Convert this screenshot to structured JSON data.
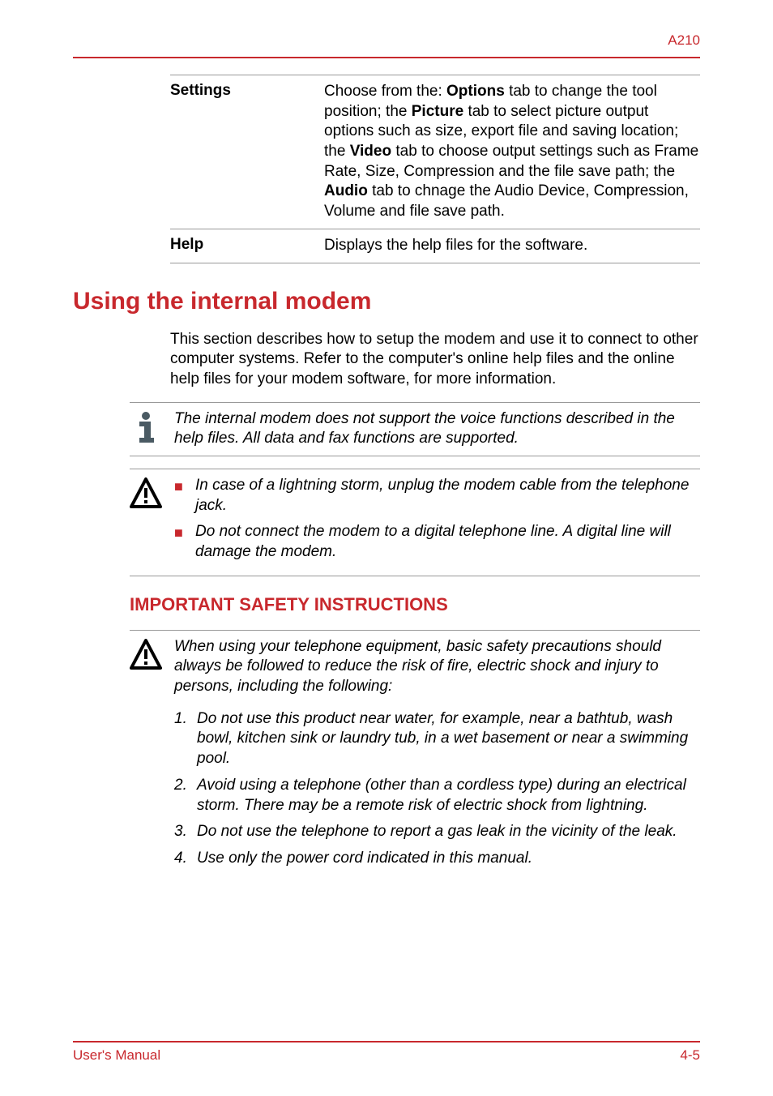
{
  "header": {
    "model": "A210"
  },
  "defs": {
    "settings": {
      "term": "Settings",
      "pre1": "Choose from the: ",
      "b1": "Options",
      "mid1": " tab to change the tool position; the ",
      "b2": "Picture",
      "mid2": " tab to select picture output options such as size, export file and saving location; the ",
      "b3": "Video",
      "mid3": " tab to choose output settings such as Frame Rate, Size, Compression and the file save path; the ",
      "b4": "Audio",
      "mid4": " tab to chnage the Audio Device, Compression, Volume and file save path."
    },
    "help": {
      "term": "Help",
      "desc": "Displays the help files for the software."
    }
  },
  "section": {
    "title": "Using the internal modem",
    "intro": "This section describes how to setup the modem and use it to connect to other computer systems. Refer to the computer's online help files and the online help files for your modem software, for more information."
  },
  "info_note": "The internal modem does not support the voice functions described in the help files. All data and fax functions are supported.",
  "warn1": {
    "item1": "In case of a lightning storm, unplug the modem cable from the telephone jack.",
    "item2": "Do not connect the modem to a digital telephone line. A digital line will damage the modem."
  },
  "safety": {
    "title": "IMPORTANT SAFETY INSTRUCTIONS",
    "intro": "When using your telephone equipment, basic safety precautions should always be followed to reduce the risk of fire, electric shock and injury to persons, including the following:",
    "items": {
      "n1": "1.",
      "t1": "Do not use this product near water, for example, near a bathtub, wash bowl, kitchen sink or laundry tub, in a wet basement or near a swimming pool.",
      "n2": "2.",
      "t2": "Avoid using a telephone (other than a cordless type) during an electrical storm. There may be a remote risk of electric shock from lightning.",
      "n3": "3.",
      "t3": "Do not use the telephone to report a gas leak in the vicinity of the leak.",
      "n4": "4.",
      "t4": "Use only the power cord indicated in this manual."
    }
  },
  "footer": {
    "left": "User's Manual",
    "right": "4-5"
  }
}
